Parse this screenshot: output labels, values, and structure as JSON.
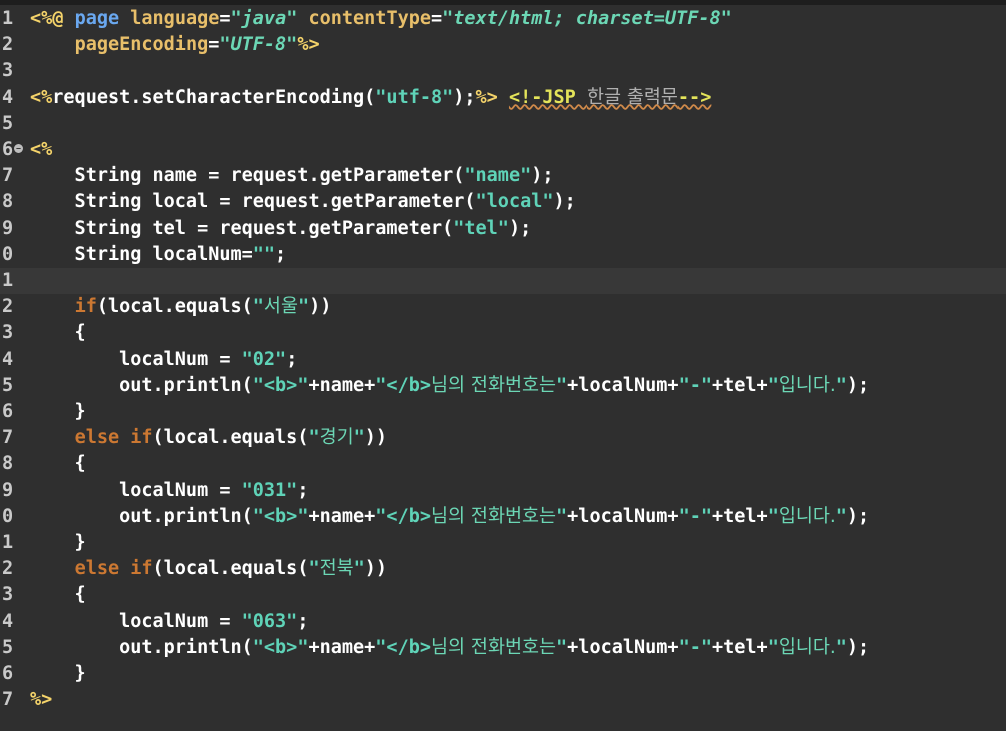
{
  "editor": {
    "lines": [
      {
        "n": "1",
        "seg": [
          [
            "delim",
            "<%@ "
          ],
          [
            "jspkw",
            "page "
          ],
          [
            "attr",
            "language"
          ],
          [
            "tag",
            "="
          ],
          [
            "val",
            "\"java\" "
          ],
          [
            "attr",
            "contentType"
          ],
          [
            "tag",
            "="
          ],
          [
            "val",
            "\"text/html; charset=UTF-8\""
          ]
        ]
      },
      {
        "n": "2",
        "seg": [
          [
            "plain",
            "    "
          ],
          [
            "attr",
            "pageEncoding"
          ],
          [
            "tag",
            "="
          ],
          [
            "val",
            "\"UTF-8\""
          ],
          [
            "delim",
            "%>"
          ]
        ]
      },
      {
        "n": "3",
        "seg": []
      },
      {
        "n": "4",
        "seg": [
          [
            "delim",
            "<%"
          ],
          [
            "tag",
            "request.setCharacterEncoding("
          ],
          [
            "str",
            "\"utf-8\""
          ],
          [
            "tag",
            ");"
          ],
          [
            "delim",
            "%> "
          ],
          [
            "cmt",
            "<!-JSP "
          ],
          [
            "cmt-kor",
            "한글 출력문"
          ],
          [
            "cmt",
            "-->"
          ]
        ]
      },
      {
        "n": "5",
        "seg": []
      },
      {
        "n": "6",
        "fold": true,
        "seg": [
          [
            "delim",
            "<%"
          ]
        ]
      },
      {
        "n": "7",
        "seg": [
          [
            "tag",
            "    String name = request.getParameter("
          ],
          [
            "str",
            "\"name\""
          ],
          [
            "tag",
            ");"
          ]
        ]
      },
      {
        "n": "8",
        "seg": [
          [
            "tag",
            "    String local = request.getParameter("
          ],
          [
            "str",
            "\"local\""
          ],
          [
            "tag",
            ");"
          ]
        ]
      },
      {
        "n": "9",
        "seg": [
          [
            "tag",
            "    String tel = request.getParameter("
          ],
          [
            "str",
            "\"tel\""
          ],
          [
            "tag",
            ");"
          ]
        ]
      },
      {
        "n": "0",
        "seg": [
          [
            "tag",
            "    String localNum="
          ],
          [
            "str",
            "\"\""
          ],
          [
            "tag",
            ";"
          ]
        ]
      },
      {
        "n": "1",
        "current": true,
        "seg": []
      },
      {
        "n": "2",
        "seg": [
          [
            "plain",
            "    "
          ],
          [
            "kw",
            "if"
          ],
          [
            "tag",
            "(local.equals("
          ],
          [
            "str",
            "\""
          ],
          [
            "kor",
            "서울"
          ],
          [
            "str",
            "\""
          ],
          [
            "tag",
            "))"
          ]
        ]
      },
      {
        "n": "3",
        "seg": [
          [
            "tag",
            "    {"
          ]
        ]
      },
      {
        "n": "4",
        "seg": [
          [
            "tag",
            "        localNum = "
          ],
          [
            "str",
            "\"02\""
          ],
          [
            "tag",
            ";"
          ]
        ]
      },
      {
        "n": "5",
        "seg": [
          [
            "tag",
            "        out.println("
          ],
          [
            "str",
            "\"<b>\""
          ],
          [
            "tag",
            "+name+"
          ],
          [
            "str",
            "\"</b>"
          ],
          [
            "kor",
            "님의 전화번호는"
          ],
          [
            "str",
            "\""
          ],
          [
            "tag",
            "+localNum+"
          ],
          [
            "str",
            "\"-\""
          ],
          [
            "tag",
            "+tel+"
          ],
          [
            "str",
            "\""
          ],
          [
            "kor",
            "입니다."
          ],
          [
            "str",
            "\""
          ],
          [
            "tag",
            ");"
          ]
        ]
      },
      {
        "n": "6",
        "seg": [
          [
            "tag",
            "    }"
          ]
        ]
      },
      {
        "n": "7",
        "seg": [
          [
            "plain",
            "    "
          ],
          [
            "kw",
            "else if"
          ],
          [
            "tag",
            "(local.equals("
          ],
          [
            "str",
            "\""
          ],
          [
            "kor",
            "경기"
          ],
          [
            "str",
            "\""
          ],
          [
            "tag",
            "))"
          ]
        ]
      },
      {
        "n": "8",
        "seg": [
          [
            "tag",
            "    {"
          ]
        ]
      },
      {
        "n": "9",
        "seg": [
          [
            "tag",
            "        localNum = "
          ],
          [
            "str",
            "\"031\""
          ],
          [
            "tag",
            ";"
          ]
        ]
      },
      {
        "n": "0",
        "seg": [
          [
            "tag",
            "        out.println("
          ],
          [
            "str",
            "\"<b>\""
          ],
          [
            "tag",
            "+name+"
          ],
          [
            "str",
            "\"</b>"
          ],
          [
            "kor",
            "님의 전화번호는"
          ],
          [
            "str",
            "\""
          ],
          [
            "tag",
            "+localNum+"
          ],
          [
            "str",
            "\"-\""
          ],
          [
            "tag",
            "+tel+"
          ],
          [
            "str",
            "\""
          ],
          [
            "kor",
            "입니다."
          ],
          [
            "str",
            "\""
          ],
          [
            "tag",
            ");"
          ]
        ]
      },
      {
        "n": "1",
        "seg": [
          [
            "tag",
            "    }"
          ]
        ]
      },
      {
        "n": "2",
        "seg": [
          [
            "plain",
            "    "
          ],
          [
            "kw",
            "else if"
          ],
          [
            "tag",
            "(local.equals("
          ],
          [
            "str",
            "\""
          ],
          [
            "kor",
            "전북"
          ],
          [
            "str",
            "\""
          ],
          [
            "tag",
            "))"
          ]
        ]
      },
      {
        "n": "3",
        "seg": [
          [
            "tag",
            "    {"
          ]
        ]
      },
      {
        "n": "4",
        "seg": [
          [
            "tag",
            "        localNum = "
          ],
          [
            "str",
            "\"063\""
          ],
          [
            "tag",
            ";"
          ]
        ]
      },
      {
        "n": "5",
        "seg": [
          [
            "tag",
            "        out.println("
          ],
          [
            "str",
            "\"<b>\""
          ],
          [
            "tag",
            "+name+"
          ],
          [
            "str",
            "\"</b>"
          ],
          [
            "kor",
            "님의 전화번호는"
          ],
          [
            "str",
            "\""
          ],
          [
            "tag",
            "+localNum+"
          ],
          [
            "str",
            "\"-\""
          ],
          [
            "tag",
            "+tel+"
          ],
          [
            "str",
            "\""
          ],
          [
            "kor",
            "입니다."
          ],
          [
            "str",
            "\""
          ],
          [
            "tag",
            ");"
          ]
        ]
      },
      {
        "n": "6",
        "seg": [
          [
            "tag",
            "    }"
          ]
        ]
      },
      {
        "n": "7",
        "seg": [
          [
            "delim",
            "%>"
          ]
        ]
      }
    ]
  }
}
